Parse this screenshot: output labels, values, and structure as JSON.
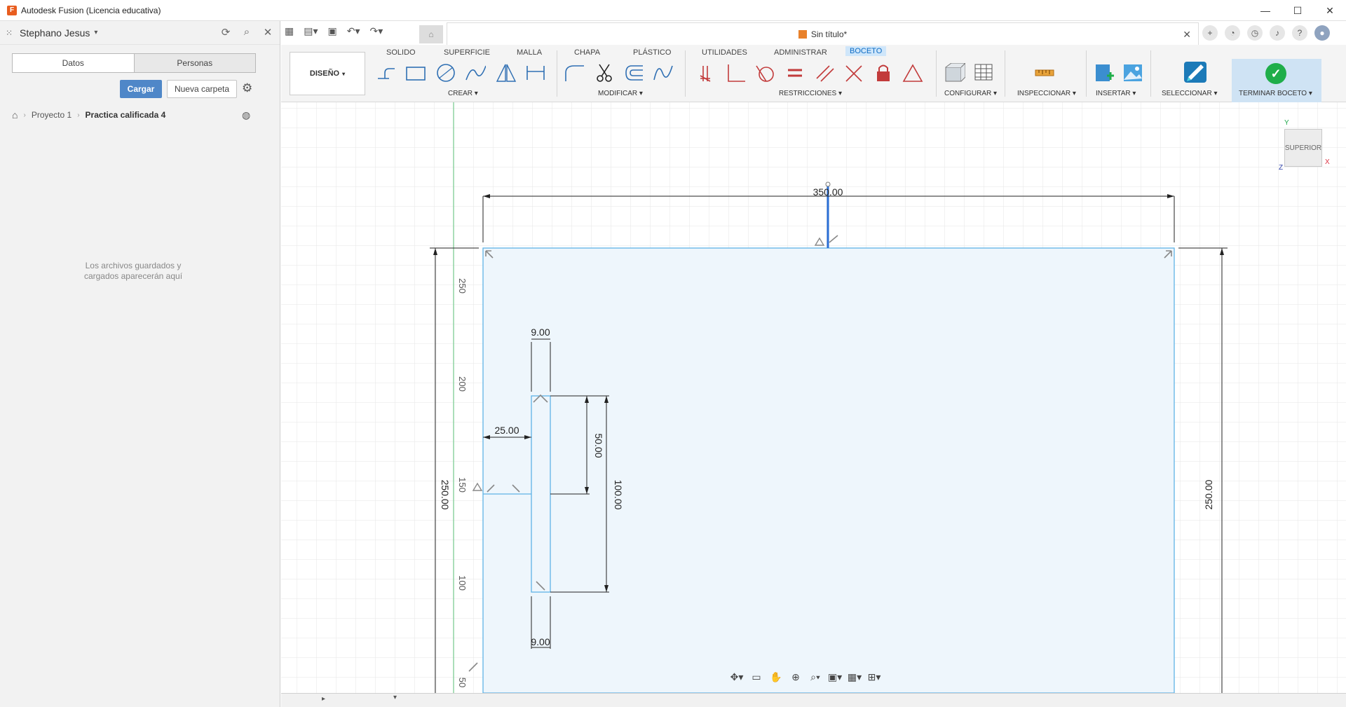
{
  "app": {
    "title": "Autodesk Fusion (Licencia educativa)",
    "logo_letter": "F",
    "win_controls": [
      "—",
      "☐",
      "✕"
    ]
  },
  "user": {
    "name": "Stephano Jesus"
  },
  "data_panel": {
    "tabs": [
      "Datos",
      "Personas"
    ],
    "upload_label": "Cargar",
    "new_folder_label": "Nueva carpeta",
    "breadcrumb": [
      "Proyecto 1",
      "Practica calificada 4"
    ],
    "empty_message_line1": "Los archivos guardados y",
    "empty_message_line2": "cargados aparecerán aquí"
  },
  "document": {
    "title": "Sin título*"
  },
  "toolbar": {
    "workspace": "DISEÑO",
    "tabs": [
      "SOLIDO",
      "SUPERFICIE",
      "MALLA",
      "CHAPA",
      "PLÁSTICO",
      "UTILIDADES",
      "ADMINISTRAR",
      "BOCETO"
    ],
    "active_tab": "BOCETO",
    "groups": [
      "CREAR",
      "MODIFICAR",
      "RESTRICCIONES",
      "CONFIGURAR",
      "INSPECCIONAR",
      "INSERTAR",
      "SELECCIONAR",
      "TERMINAR BOCETO"
    ],
    "accent": "#0e6cc4",
    "finish_color": "#1fae4a"
  },
  "viewcube": {
    "face": "SUPERIOR",
    "x": "X",
    "y": "Y",
    "z": "Z"
  },
  "sketch": {
    "dims": {
      "width": "350.00",
      "height_left": "250.00",
      "height_right": "250.00",
      "slot_top_width": "9.00",
      "slot_bottom_width": "9.00",
      "offset": "25.00",
      "slot_half": "50.00",
      "slot_full": "100.00"
    },
    "ruler": [
      "250",
      "200",
      "150",
      "100",
      "50"
    ],
    "fill_color": "#eef6fc",
    "line_color": "#5fb3e6"
  }
}
